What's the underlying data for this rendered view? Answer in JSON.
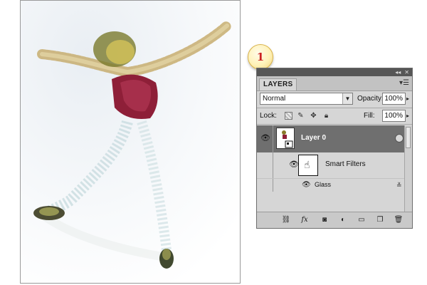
{
  "step": "1",
  "panel": {
    "tab_label": "LAYERS",
    "titlebar_buttons": [
      "◂◂",
      "✕"
    ],
    "menu_icon": "panel-menu-icon",
    "blend_mode": "Normal",
    "opacity_label": "Opacity:",
    "opacity_value": "100%",
    "lock_label": "Lock:",
    "fill_label": "Fill:",
    "fill_value": "100%",
    "layers": {
      "layer_name": "Layer 0",
      "smart_filters_label": "Smart Filters",
      "filter_name": "Glass"
    },
    "bottom_icons": [
      "link-icon",
      "fx-icon",
      "mask-icon",
      "adjustment-icon",
      "folder-icon",
      "new-layer-icon",
      "trash-icon"
    ]
  },
  "colors": {
    "panel_bg": "#d6d6d6",
    "selected_row": "#6f6f6f",
    "badge_number": "#cc2222"
  }
}
